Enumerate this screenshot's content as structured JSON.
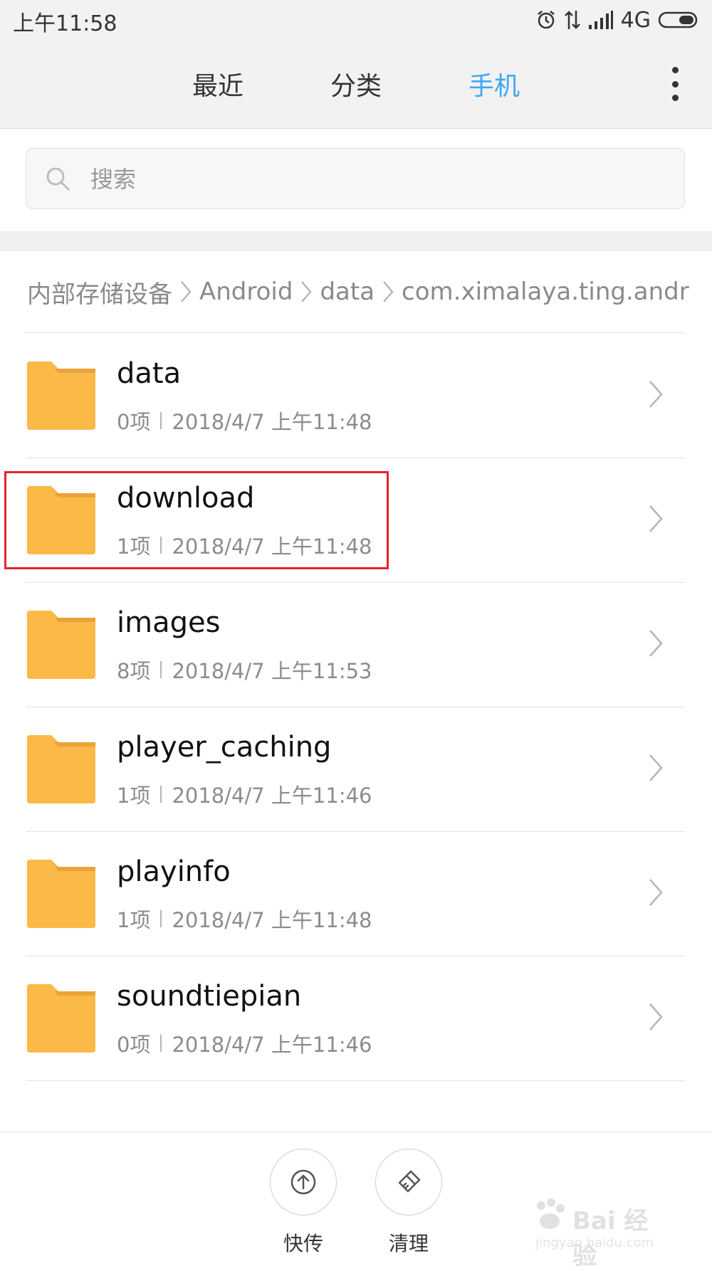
{
  "status_bar": {
    "time": "上午11:58",
    "network": "4G"
  },
  "tabs": [
    {
      "label": "最近",
      "active": false
    },
    {
      "label": "分类",
      "active": false
    },
    {
      "label": "手机",
      "active": true
    }
  ],
  "search": {
    "placeholder": "搜索"
  },
  "breadcrumb": [
    "内部存储设备",
    "Android",
    "data",
    "com.ximalaya.ting.andr"
  ],
  "items": [
    {
      "name": "data",
      "count": "0项",
      "date": "2018/4/7 上午11:48"
    },
    {
      "name": "download",
      "count": "1项",
      "date": "2018/4/7 上午11:48"
    },
    {
      "name": "images",
      "count": "8项",
      "date": "2018/4/7 上午11:53"
    },
    {
      "name": "player_caching",
      "count": "1项",
      "date": "2018/4/7 上午11:46"
    },
    {
      "name": "playinfo",
      "count": "1项",
      "date": "2018/4/7 上午11:48"
    },
    {
      "name": "soundtiepian",
      "count": "0项",
      "date": "2018/4/7 上午11:46"
    }
  ],
  "bottom_actions": [
    {
      "label": "快传",
      "icon": "upload-icon"
    },
    {
      "label": "清理",
      "icon": "brush-icon"
    }
  ],
  "watermark": {
    "text": "Bai 经验",
    "sub": "jingyan.baidu.com"
  },
  "colors": {
    "accent": "#3fa8f4",
    "folder": "#fbb948",
    "highlight": "#e8232a"
  }
}
